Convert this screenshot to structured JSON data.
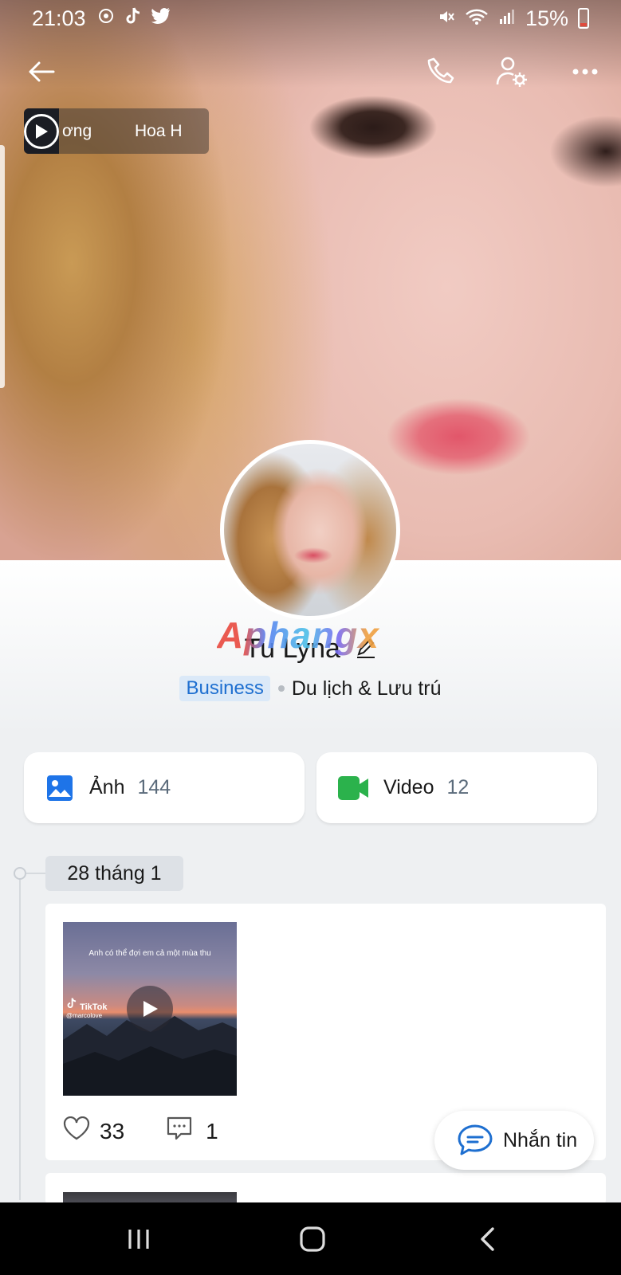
{
  "status_bar": {
    "time": "21:03",
    "battery": "15%",
    "icons": [
      "sync-icon",
      "tiktok-icon",
      "twitter-icon",
      "mute-icon",
      "wifi-icon",
      "signal-icon",
      "battery-icon"
    ]
  },
  "top_bar": {
    "icons": [
      "back-arrow-icon",
      "phone-icon",
      "user-settings-icon",
      "more-icon"
    ]
  },
  "music": {
    "text_a": "ơng",
    "text_b": "Hoa H"
  },
  "profile": {
    "name": "Tu Lyna",
    "badge": "Business",
    "category": "Du lịch & Lưu trú",
    "watermark": "Aphangx"
  },
  "media": {
    "photos_label": "Ảnh",
    "photos_count": "144",
    "videos_label": "Video",
    "videos_count": "12"
  },
  "timeline": {
    "date": "28 tháng 1",
    "post": {
      "video_caption": "Anh có thể đợi em cả một mùa thu",
      "tiktok_label": "TikTok",
      "tiktok_handle": "@marcolove",
      "likes": "33",
      "comments": "1"
    }
  },
  "message_button": {
    "label": "Nhắn tin"
  },
  "colors": {
    "accent": "#1e6fd0",
    "photo_icon": "#1e74e8",
    "video_icon": "#2bb24c",
    "badge_bg": "#dbe9f8"
  }
}
